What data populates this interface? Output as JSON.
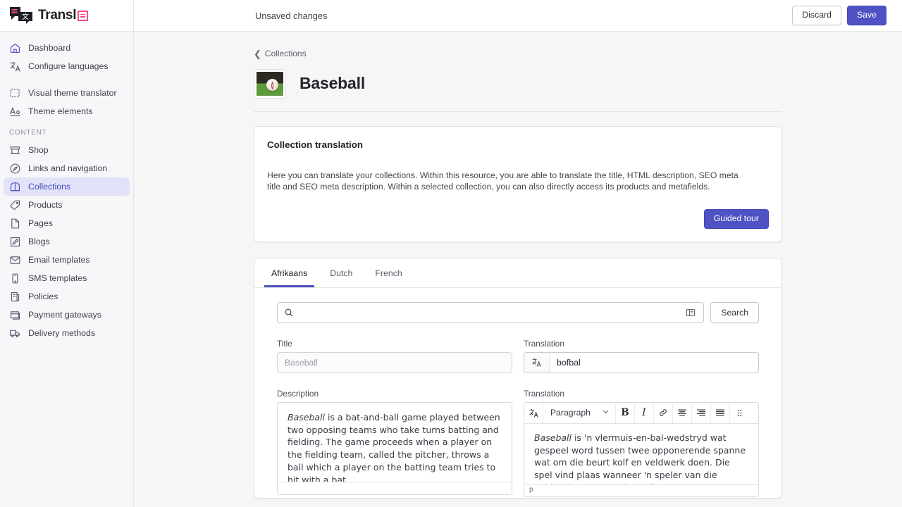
{
  "brand": {
    "name": "Transl",
    "badge_icon": "square-badge-icon",
    "logo_icon": "translation-chat-logo-icon"
  },
  "topbar": {
    "status": "Unsaved changes",
    "discard_label": "Discard",
    "save_label": "Save"
  },
  "sidebar": {
    "primary": [
      {
        "label": "Dashboard",
        "icon": "home-icon"
      },
      {
        "label": "Configure languages",
        "icon": "translate-icon"
      }
    ],
    "secondary": [
      {
        "label": "Visual theme translator",
        "icon": "theme-edit-icon"
      },
      {
        "label": "Theme elements",
        "icon": "typography-icon"
      }
    ],
    "content_title": "CONTENT",
    "content_items": [
      {
        "label": "Shop",
        "icon": "store-icon",
        "active": false
      },
      {
        "label": "Links and navigation",
        "icon": "compass-icon",
        "active": false
      },
      {
        "label": "Collections",
        "icon": "collection-icon",
        "active": true
      },
      {
        "label": "Products",
        "icon": "tag-icon",
        "active": false
      },
      {
        "label": "Pages",
        "icon": "page-icon",
        "active": false
      },
      {
        "label": "Blogs",
        "icon": "blog-edit-icon",
        "active": false
      },
      {
        "label": "Email templates",
        "icon": "envelope-icon",
        "active": false
      },
      {
        "label": "SMS templates",
        "icon": "mobile-icon",
        "active": false
      },
      {
        "label": "Policies",
        "icon": "policy-scroll-icon",
        "active": false
      },
      {
        "label": "Payment gateways",
        "icon": "payment-card-icon",
        "active": false
      },
      {
        "label": "Delivery methods",
        "icon": "truck-icon",
        "active": false
      }
    ]
  },
  "page": {
    "breadcrumb": "Collections",
    "breadcrumb_icon": "chevron-left-icon",
    "title": "Baseball",
    "thumbnail_icon": "baseball-thumbnail"
  },
  "info_card": {
    "title": "Collection translation",
    "body": "Here you can translate your collections. Within this resource, you are able to translate the title, HTML description, SEO meta title and SEO meta description. Within a selected collection, you can also directly access its products and metafields.",
    "guided_tour_label": "Guided tour"
  },
  "tabs": [
    {
      "label": "Afrikaans",
      "active": true
    },
    {
      "label": "Dutch",
      "active": false
    },
    {
      "label": "French",
      "active": false
    }
  ],
  "search": {
    "value": "",
    "placeholder": "",
    "icon": "search-icon",
    "view_toggle_icon": "layout-panel-icon",
    "button_label": "Search"
  },
  "title_field": {
    "label": "Title",
    "value": "Baseball",
    "readonly": true
  },
  "title_translation": {
    "label": "Translation",
    "value": "bofbal",
    "icon": "translate-icon"
  },
  "description_field": {
    "label": "Description",
    "emphasis": "Baseball",
    "body": " is a bat-and-ball game played between two opposing teams who take turns batting and fielding. The game proceeds when a player on the fielding team, called the pitcher, throws a ball which a player on the batting team tries to hit with a bat.",
    "statusbar": ""
  },
  "description_translation": {
    "label": "Translation",
    "emphasis": "Baseball",
    "body": " is 'n vlermuis-en-bal-wedstryd wat gespeel word tussen twee opponerende spanne wat om die beurt kolf en veldwerk doen. Die spel vind plaas wanneer 'n speler van die veldwerkspan, wat die kruik genoem word, 'n bal gooi wat 'n speler in die kolfspan",
    "statusbar": "p",
    "toolbar": {
      "translate_icon": "translate-icon",
      "block_format": "Paragraph",
      "chevron_icon": "chevron-down-icon",
      "bold_label": "B",
      "italic_label": "I",
      "link_icon": "link-icon",
      "align_center_icon": "align-center-icon",
      "align_right_icon": "align-right-icon",
      "align_justify_icon": "align-justify-icon",
      "drag_handle_icon": "grip-dots-icon"
    }
  },
  "colors": {
    "accent": "#4f52c3",
    "accent_soft": "#e2e3f8",
    "brand_pink": "#ff4d82",
    "page_bg": "#f6f6f7",
    "border": "#e0e0e6"
  }
}
